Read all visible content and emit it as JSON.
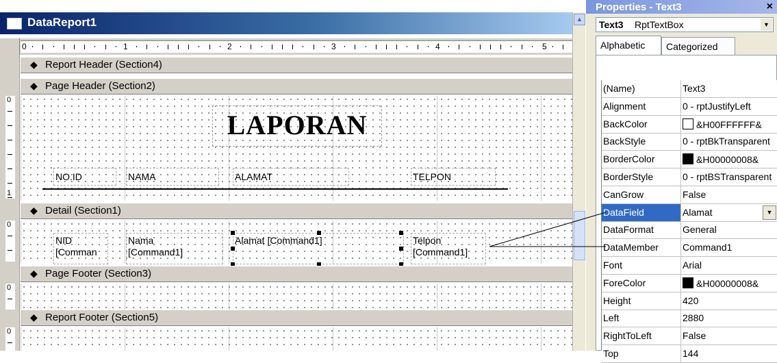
{
  "designer": {
    "title": "DataReport1",
    "ruler_numbers": [
      "0",
      "1",
      "2",
      "3",
      "4",
      "5"
    ],
    "vertical_ruler_marks": [
      "0",
      "1"
    ],
    "sections": {
      "report_header": "Report Header (Section4)",
      "page_header": "Page Header (Section2)",
      "detail": "Detail (Section1)",
      "page_footer": "Page Footer (Section3)",
      "report_footer": "Report Footer (Section5)"
    },
    "page_header": {
      "title_label": "LAPORAN",
      "columns": [
        "NO.ID",
        "NAMA",
        "ALAMAT",
        "TELPON"
      ]
    },
    "detail": {
      "fields": [
        {
          "line1": "NID",
          "line2": "[Comman"
        },
        {
          "line1": "Nama",
          "line2": "[Command1]"
        },
        {
          "line1": "Alamat [Command1]",
          "line2": ""
        },
        {
          "line1": "Telpon",
          "line2": "[Command1]"
        }
      ]
    }
  },
  "properties": {
    "title": "Properties - Text3",
    "close_glyph": "×",
    "object_name": "Text3",
    "object_type": "RptTextBox",
    "tabs": [
      "Alphabetic",
      "Categorized"
    ],
    "selected_row": "DataField",
    "rows": [
      {
        "name": "(Name)",
        "value": "Text3"
      },
      {
        "name": "Alignment",
        "value": "0 - rptJustifyLeft"
      },
      {
        "name": "BackColor",
        "value": "&H00FFFFFF&",
        "swatch": "#ffffff"
      },
      {
        "name": "BackStyle",
        "value": "0 - rptBkTransparent"
      },
      {
        "name": "BorderColor",
        "value": "&H00000008&",
        "swatch": "#000000"
      },
      {
        "name": "BorderStyle",
        "value": "0 - rptBSTransparent"
      },
      {
        "name": "CanGrow",
        "value": "False"
      },
      {
        "name": "DataField",
        "value": "Alamat"
      },
      {
        "name": "DataFormat",
        "value": "General"
      },
      {
        "name": "DataMember",
        "value": "Command1"
      },
      {
        "name": "Font",
        "value": "Arial"
      },
      {
        "name": "ForeColor",
        "value": "&H00000008&",
        "swatch": "#000000"
      },
      {
        "name": "Height",
        "value": "420"
      },
      {
        "name": "Left",
        "value": "2880"
      },
      {
        "name": "RightToLeft",
        "value": "False"
      },
      {
        "name": "Top",
        "value": "144"
      }
    ]
  },
  "colors": {
    "title_bar": "#0a246a",
    "selection": "#316ac5",
    "panel": "#ece9d8"
  }
}
